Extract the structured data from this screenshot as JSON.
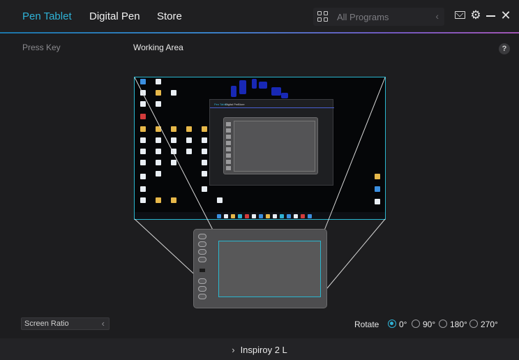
{
  "tabs": [
    {
      "label": "Pen Tablet",
      "active": true
    },
    {
      "label": "Digital Pen",
      "active": false
    },
    {
      "label": "Store",
      "active": false
    }
  ],
  "programs": {
    "label": "All Programs"
  },
  "subheader": {
    "left": "Press Key",
    "middle": "Working Area",
    "help": "?"
  },
  "inner_window": {
    "tabs": [
      "Pen Tablet",
      "Digital Pen",
      "Store"
    ]
  },
  "screen_ratio": {
    "label": "Screen Ratio"
  },
  "rotate": {
    "label": "Rotate",
    "options": [
      "0°",
      "90°",
      "180°",
      "270°"
    ],
    "selected": "0°"
  },
  "device": {
    "name": "Inspiroy 2 L"
  },
  "colors": {
    "accent": "#2fb2d6",
    "background": "#1d1d1f",
    "selection_outline": "#29b6cf"
  }
}
